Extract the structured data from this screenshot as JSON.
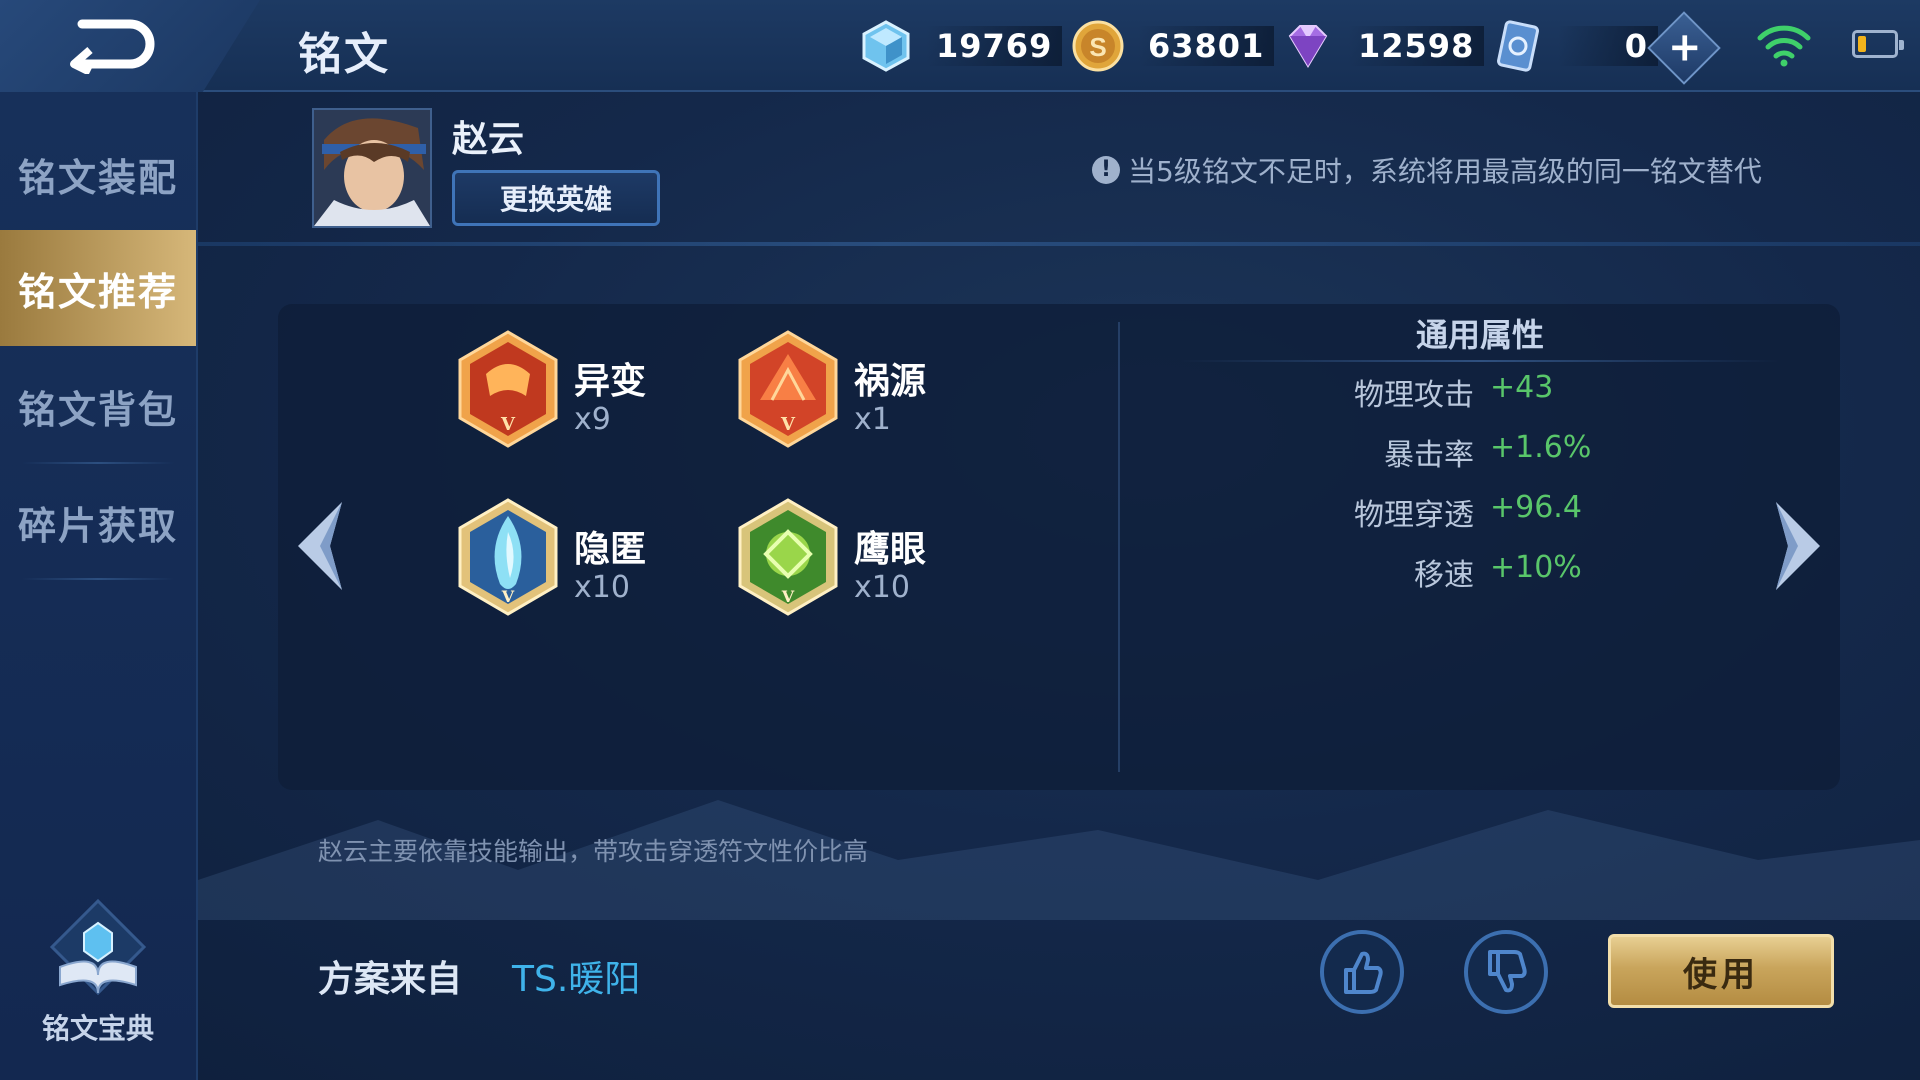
{
  "header": {
    "title": "铭文",
    "currencies": [
      {
        "icon": "diamond-crystal-icon",
        "value": "19769"
      },
      {
        "icon": "gold-coin-icon",
        "value": "63801"
      },
      {
        "icon": "purple-gem-icon",
        "value": "12598"
      },
      {
        "icon": "rune-ticket-icon",
        "value": "0"
      }
    ]
  },
  "sidebar": {
    "items": [
      {
        "label": "铭文装配",
        "active": false
      },
      {
        "label": "铭文推荐",
        "active": true
      },
      {
        "label": "铭文背包",
        "active": false
      },
      {
        "label": "碎片获取",
        "active": false
      }
    ],
    "codex_label": "铭文宝典"
  },
  "hero": {
    "name": "赵云",
    "change_button": "更换英雄"
  },
  "notice": "当5级铭文不足时，系统将用最高级的同一铭文替代",
  "runes": [
    {
      "name": "异变",
      "count": "x9",
      "color": "red"
    },
    {
      "name": "祸源",
      "count": "x1",
      "color": "red"
    },
    {
      "name": "隐匿",
      "count": "x10",
      "color": "blue"
    },
    {
      "name": "鹰眼",
      "count": "x10",
      "color": "green"
    }
  ],
  "attributes": {
    "title": "通用属性",
    "rows": [
      {
        "name": "物理攻击",
        "value": "+43"
      },
      {
        "name": "暴击率",
        "value": "+1.6%"
      },
      {
        "name": "物理穿透",
        "value": "+96.4"
      },
      {
        "name": "移速",
        "value": "+10%"
      }
    ]
  },
  "description": "赵云主要依靠技能输出，带攻击穿透符文性价比高",
  "source": {
    "label": "方案来自",
    "author": "TS.暖阳"
  },
  "actions": {
    "use_label": "使用"
  },
  "colors": {
    "accent_gold": "#d6b779",
    "stat_green": "#59c66a",
    "author_blue": "#3fb3ea"
  }
}
